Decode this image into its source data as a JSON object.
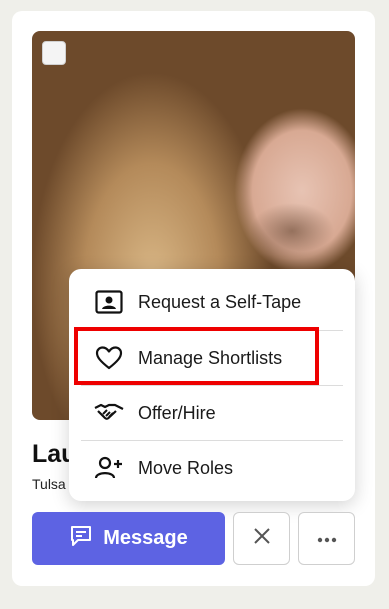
{
  "card": {
    "name": "Lau",
    "location": "Tulsa",
    "photo_alt": "profile-photo"
  },
  "menu": {
    "items": [
      {
        "label": "Request a Self-Tape",
        "icon": "person-id-icon"
      },
      {
        "label": "Manage Shortlists",
        "icon": "heart-icon"
      },
      {
        "label": "Offer/Hire",
        "icon": "handshake-icon"
      },
      {
        "label": "Move Roles",
        "icon": "person-add-icon"
      }
    ]
  },
  "actions": {
    "message_label": "Message",
    "dismiss_icon": "close-icon",
    "more_icon": "more-horizontal-icon"
  },
  "colors": {
    "primary": "#5d63e3",
    "highlight": "#ee0000"
  }
}
